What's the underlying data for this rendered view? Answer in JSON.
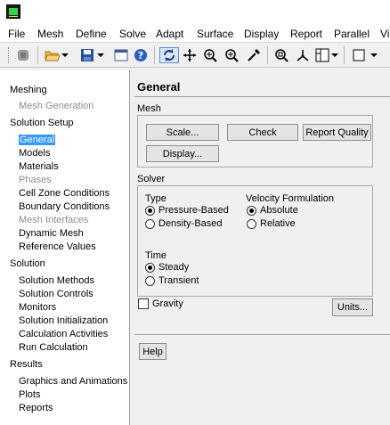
{
  "menubar": {
    "items": [
      "File",
      "Mesh",
      "Define",
      "Solve",
      "Adapt",
      "Surface",
      "Display",
      "Report",
      "Parallel",
      "Vi"
    ]
  },
  "toolbar": {
    "icons": [
      "read-case-icon",
      "open-folder-icon",
      "save-icon",
      "help-icon",
      "rotate-icon",
      "pan-icon",
      "zoom-in-icon",
      "zoom-icon",
      "probe-icon",
      "zoom-fit-icon",
      "axes-icon",
      "layout-icon",
      "window-icon"
    ]
  },
  "tree": {
    "items": [
      {
        "label": "Meshing",
        "type": "head"
      },
      {
        "label": "Mesh Generation",
        "type": "dis"
      },
      {
        "label": "Solution Setup",
        "type": "head"
      },
      {
        "label": "General",
        "type": "sel"
      },
      {
        "label": "Models",
        "type": "sub"
      },
      {
        "label": "Materials",
        "type": "sub"
      },
      {
        "label": "Phases",
        "type": "dis"
      },
      {
        "label": "Cell Zone Conditions",
        "type": "sub"
      },
      {
        "label": "Boundary Conditions",
        "type": "sub"
      },
      {
        "label": "Mesh Interfaces",
        "type": "dis"
      },
      {
        "label": "Dynamic Mesh",
        "type": "sub"
      },
      {
        "label": "Reference Values",
        "type": "sub"
      },
      {
        "label": "Solution",
        "type": "head"
      },
      {
        "label": "Solution Methods",
        "type": "sub"
      },
      {
        "label": "Solution Controls",
        "type": "sub"
      },
      {
        "label": "Monitors",
        "type": "sub"
      },
      {
        "label": "Solution Initialization",
        "type": "sub"
      },
      {
        "label": "Calculation Activities",
        "type": "sub"
      },
      {
        "label": "Run Calculation",
        "type": "sub"
      },
      {
        "label": "Results",
        "type": "head"
      },
      {
        "label": "Graphics and Animations",
        "type": "sub"
      },
      {
        "label": "Plots",
        "type": "sub"
      },
      {
        "label": "Reports",
        "type": "sub"
      }
    ]
  },
  "panel": {
    "title": "General",
    "mesh": {
      "label": "Mesh",
      "scale_button": "Scale...",
      "check_button": "Check",
      "report_quality_button": "Report Quality",
      "display_button": "Display..."
    },
    "solver": {
      "label": "Solver",
      "type_label": "Type",
      "type_options": [
        {
          "label": "Pressure-Based",
          "selected": true
        },
        {
          "label": "Density-Based",
          "selected": false
        }
      ],
      "velocity_label": "Velocity Formulation",
      "velocity_options": [
        {
          "label": "Absolute",
          "selected": true
        },
        {
          "label": "Relative",
          "selected": false
        }
      ],
      "time_label": "Time",
      "time_options": [
        {
          "label": "Steady",
          "selected": true
        },
        {
          "label": "Transient",
          "selected": false
        }
      ]
    },
    "gravity": {
      "label": "Gravity",
      "checked": false
    },
    "units_button": "Units...",
    "help_button": "Help"
  }
}
